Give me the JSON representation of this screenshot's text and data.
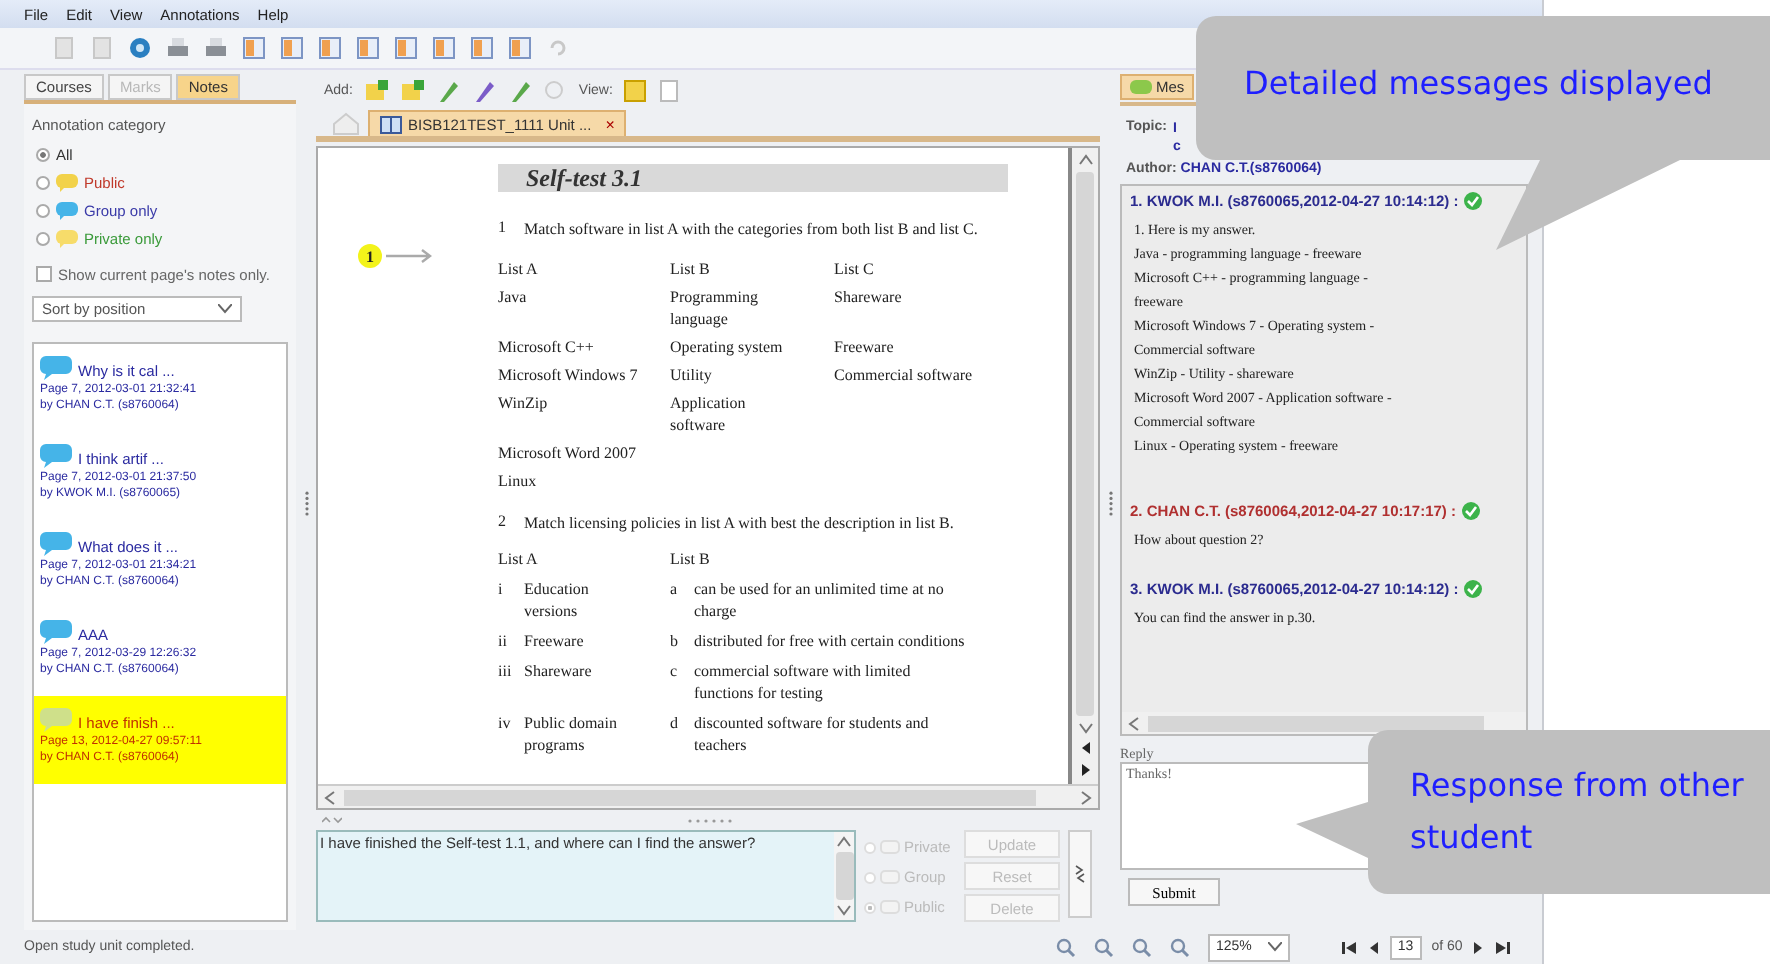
{
  "menu": [
    "File",
    "Edit",
    "View",
    "Annotations",
    "Help"
  ],
  "left_tabs": [
    {
      "label": "Courses",
      "selected": false,
      "disabled": false
    },
    {
      "label": "Marks",
      "selected": false,
      "disabled": true
    },
    {
      "label": "Notes",
      "selected": true,
      "disabled": false
    }
  ],
  "annotation_category": {
    "title": "Annotation category",
    "options": [
      {
        "label": "All",
        "selected": true,
        "color": "#333333"
      },
      {
        "label": "Public",
        "selected": false,
        "color": "#c0392b"
      },
      {
        "label": "Group only",
        "selected": false,
        "color": "#3a3aa8"
      },
      {
        "label": "Private only",
        "selected": false,
        "color": "#3a9a3a"
      }
    ]
  },
  "show_current_page": {
    "label": "Show current page's notes only.",
    "checked": false
  },
  "sort": {
    "value": "Sort by position"
  },
  "notes": [
    {
      "title": "Why is it cal ...",
      "meta": "Page 7, 2012-03-01 21:32:41",
      "author": "by CHAN C.T. (s8760064)",
      "color": "#45b4e8",
      "selected": false
    },
    {
      "title": "I think artif ...",
      "meta": "Page 7, 2012-03-01 21:37:50",
      "author": "by KWOK M.I. (s8760065)",
      "color": "#45b4e8",
      "selected": false
    },
    {
      "title": "What does it ...",
      "meta": "Page 7, 2012-03-01 21:34:21",
      "author": "by CHAN C.T. (s8760064)",
      "color": "#45b4e8",
      "selected": false
    },
    {
      "title": "AAA",
      "meta": "Page 7, 2012-03-29 12:26:32",
      "author": "by CHAN C.T. (s8760064)",
      "color": "#45b4e8",
      "selected": false
    },
    {
      "title": "I have finish ...",
      "meta": "Page 13, 2012-04-27 09:57:11",
      "author": "by CHAN C.T. (s8760064)",
      "color": "#cfe08a",
      "selected": true
    }
  ],
  "add_toolbar": {
    "label": "Add:",
    "view_label": "View:"
  },
  "doc_tab": {
    "label": "BISB121TEST_1111 Unit ...",
    "close": "×"
  },
  "document": {
    "heading": "Self-test 3.1",
    "marker": "1",
    "q1": {
      "number": "1",
      "text": "Match software in list A with the categories from both list B and list C.",
      "columns": [
        "List A",
        "List B",
        "List C"
      ],
      "rows": [
        [
          "Java",
          "Programming language",
          "Shareware"
        ],
        [
          "Microsoft C++",
          "Operating system",
          "Freeware"
        ],
        [
          "Microsoft Windows 7",
          "Utility",
          "Commercial software"
        ],
        [
          "WinZip",
          "Application software"
        ],
        [
          "Microsoft Word 2007"
        ],
        [
          "Linux"
        ]
      ]
    },
    "q2": {
      "number": "2",
      "text": "Match licensing policies in list A with best the description in list B.",
      "columns": [
        "List A",
        "List B"
      ],
      "rows": [
        {
          "a_mark": "i",
          "a": "Education versions",
          "b_mark": "a",
          "b": "can be used for an unlimited time at no charge"
        },
        {
          "a_mark": "ii",
          "a": "Freeware",
          "b_mark": "b",
          "b": "distributed for free with certain conditions"
        },
        {
          "a_mark": "iii",
          "a": "Shareware",
          "b_mark": "c",
          "b": "commercial software with limited functions for testing"
        },
        {
          "a_mark": "iv",
          "a": "Public domain programs",
          "b_mark": "d",
          "b": "discounted software for students and teachers"
        }
      ]
    }
  },
  "note_editor": {
    "text": "I have finished the Self-test 1.1, and where can I find the answer?",
    "scopes": [
      {
        "label": "Private",
        "selected": false
      },
      {
        "label": "Group",
        "selected": false
      },
      {
        "label": "Public",
        "selected": true
      }
    ],
    "buttons": [
      {
        "label": "Update",
        "disabled": true
      },
      {
        "label": "Reset",
        "disabled": true
      },
      {
        "label": "Delete",
        "disabled": true
      }
    ]
  },
  "messages_panel": {
    "tab": "Mes",
    "topic_label": "Topic:",
    "topic": [
      "I",
      "c"
    ],
    "author_label": "Author:",
    "author": "CHAN C.T.(s8760064)",
    "messages": [
      {
        "header": "1. KWOK M.I. (s8760065,2012-04-27 10:14:12) :",
        "color": "#2b2b8f",
        "lines": [
          "1. Here is my answer.",
          "Java - programming language - freeware",
          "Microsoft C++ - programming language -",
          "freeware",
          "Microsoft Windows 7 - Operating system -",
          "Commercial software",
          "WinZip - Utility - shareware",
          "Microsoft Word 2007 - Application software -",
          "Commercial software",
          "Linux - Operating system - freeware"
        ]
      },
      {
        "header": "2. CHAN C.T. (s8760064,2012-04-27 10:17:17) :",
        "color": "#b03030",
        "lines": [
          "How about question 2?"
        ]
      },
      {
        "header": "3. KWOK M.I. (s8760065,2012-04-27 10:14:12) :",
        "color": "#2b2b8f",
        "lines": [
          "You can find the answer in p.30."
        ]
      }
    ],
    "reply_label": "Reply",
    "reply_value": "Thanks!",
    "submit": "Submit"
  },
  "status_bar": "Open study unit completed.",
  "zoom": {
    "value": "125%"
  },
  "pager": {
    "page": "13",
    "of": "of 60"
  },
  "callouts": [
    {
      "text": "Detailed messages displayed"
    },
    {
      "text": "Response from other student"
    }
  ]
}
